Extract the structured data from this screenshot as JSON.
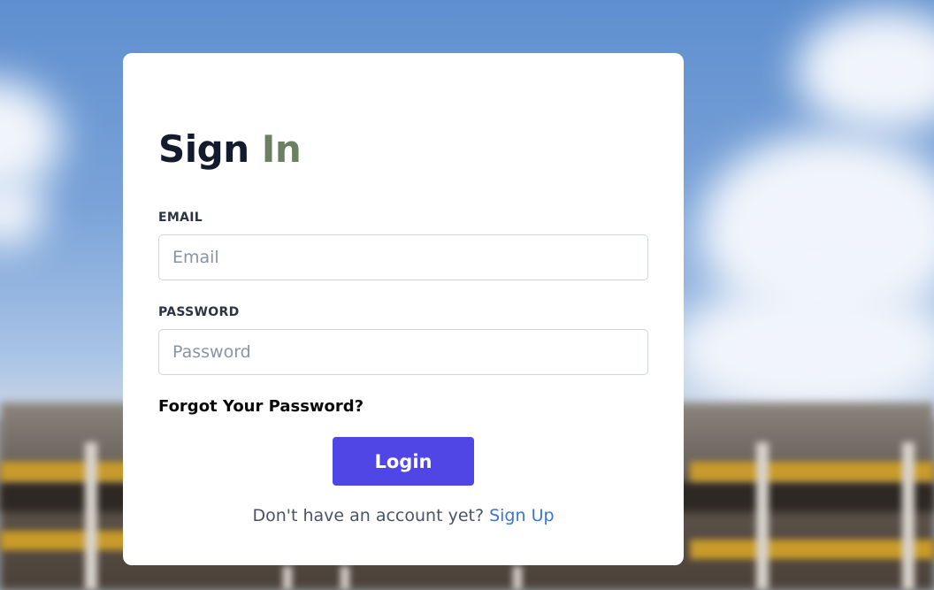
{
  "signin": {
    "title_word1": "Sign",
    "title_word2": "In",
    "title_color_primary": "#141b2d",
    "title_color_accent": "#6b7f63"
  },
  "form": {
    "email_label": "EMAIL",
    "email_placeholder": "Email",
    "email_value": "",
    "password_label": "PASSWORD",
    "password_placeholder": "Password",
    "password_value": "",
    "forgot_link": "Forgot Your Password?",
    "login_button": "Login",
    "login_button_color": "#4f46e5"
  },
  "signup": {
    "prompt": "Don't have an account yet?",
    "link": "Sign Up",
    "link_color": "#3b74d6"
  }
}
